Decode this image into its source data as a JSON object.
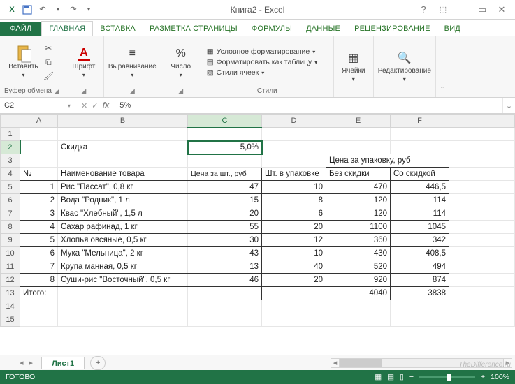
{
  "title": "Книга2 - Excel",
  "qat": {
    "save": "save-icon",
    "undo": "undo-icon",
    "redo": "redo-icon"
  },
  "windowControls": {
    "help": "?",
    "ribbonOpts": "⋯",
    "min": "—",
    "max": "▭",
    "close": "✕"
  },
  "tabs": {
    "file": "ФАЙЛ",
    "home": "ГЛАВНАЯ",
    "insert": "ВСТАВКА",
    "pageLayout": "РАЗМЕТКА СТРАНИЦЫ",
    "formulas": "ФОРМУЛЫ",
    "data": "ДАННЫЕ",
    "review": "РЕЦЕНЗИРОВАНИЕ",
    "view": "ВИД"
  },
  "ribbon": {
    "clipboard": {
      "paste": "Вставить",
      "label": "Буфер обмена"
    },
    "font": {
      "btn": "Шрифт",
      "label": ""
    },
    "align": {
      "btn": "Выравнивание",
      "label": ""
    },
    "number": {
      "btn": "Число",
      "label": ""
    },
    "styles": {
      "cond": "Условное форматирование",
      "table": "Форматировать как таблицу",
      "cell": "Стили ячеек",
      "label": "Стили"
    },
    "cells": {
      "btn": "Ячейки",
      "label": ""
    },
    "editing": {
      "btn": "Редактирование",
      "label": ""
    }
  },
  "nameBox": "C2",
  "formula": "5%",
  "columns": [
    "A",
    "B",
    "C",
    "D",
    "E",
    "F"
  ],
  "rows": [
    "1",
    "2",
    "3",
    "4",
    "5",
    "6",
    "7",
    "8",
    "9",
    "10",
    "11",
    "12",
    "13",
    "14",
    "15"
  ],
  "sheet": {
    "discountLabel": "Скидка",
    "discountValue": "5,0%",
    "priceHeader": "Цена за упаковку, руб",
    "h_no": "№",
    "h_name": "Наименование товара",
    "h_unitPrice": "Цена за шт., руб",
    "h_qty": "Шт. в упаковке",
    "h_noDisc": "Без скидки",
    "h_withDisc": "Со скидкой",
    "rows": [
      {
        "no": "1",
        "name": "Рис \"Пассат\", 0,8 кг",
        "price": "47",
        "qty": "10",
        "noDisc": "470",
        "withDisc": "446,5"
      },
      {
        "no": "2",
        "name": "Вода \"Родник\", 1 л",
        "price": "15",
        "qty": "8",
        "noDisc": "120",
        "withDisc": "114"
      },
      {
        "no": "3",
        "name": "Квас \"Хлебный\", 1,5 л",
        "price": "20",
        "qty": "6",
        "noDisc": "120",
        "withDisc": "114"
      },
      {
        "no": "4",
        "name": "Сахар рафинад, 1 кг",
        "price": "55",
        "qty": "20",
        "noDisc": "1100",
        "withDisc": "1045"
      },
      {
        "no": "5",
        "name": "Хлопья овсяные, 0,5 кг",
        "price": "30",
        "qty": "12",
        "noDisc": "360",
        "withDisc": "342"
      },
      {
        "no": "6",
        "name": "Мука \"Мельница\", 2 кг",
        "price": "43",
        "qty": "10",
        "noDisc": "430",
        "withDisc": "408,5"
      },
      {
        "no": "7",
        "name": "Крупа манная, 0,5 кг",
        "price": "13",
        "qty": "40",
        "noDisc": "520",
        "withDisc": "494"
      },
      {
        "no": "8",
        "name": "Суши-рис \"Восточный\", 0,5 кг",
        "price": "46",
        "qty": "20",
        "noDisc": "920",
        "withDisc": "874"
      }
    ],
    "totalLabel": "Итого:",
    "totalNoDisc": "4040",
    "totalWithDisc": "3838"
  },
  "sheetTab": "Лист1",
  "status": {
    "ready": "ГОТОВО",
    "zoom": "100%"
  },
  "watermark": "TheDifference.ru"
}
